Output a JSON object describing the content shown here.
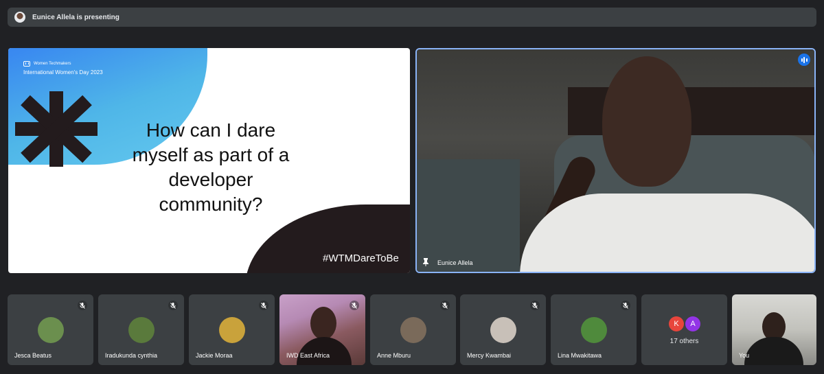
{
  "presenting": {
    "text": "Eunice Allela is presenting"
  },
  "slide": {
    "brand": "Women Techmakers",
    "event": "International Women's Day 2023",
    "title": "How can I dare myself as part of a developer community?",
    "hashtag": "#WTMDareToBe"
  },
  "main_video": {
    "name": "Eunice Allela",
    "speaking": true
  },
  "participants": [
    {
      "name": "Jesca Beatus",
      "muted": true,
      "avatar_color": "#6b8f4e"
    },
    {
      "name": "Iradukunda cynthia",
      "muted": true,
      "avatar_color": "#5a7a3c"
    },
    {
      "name": "Jackie Moraa",
      "muted": true,
      "avatar_color": "#c9a23b"
    },
    {
      "name": "IWD East Africa",
      "muted": true,
      "video": true
    },
    {
      "name": "Anne Mburu",
      "muted": true,
      "avatar_color": "#7a6a5a"
    },
    {
      "name": "Mercy Kwambai",
      "muted": true,
      "avatar_color": "#c8c0b8"
    },
    {
      "name": "Lina Mwakitawa",
      "muted": true,
      "avatar_color": "#4f8a3c"
    }
  ],
  "others": {
    "initials": [
      "K",
      "A"
    ],
    "colors": [
      "#e8453c",
      "#9334e6"
    ],
    "count_label": "17 others"
  },
  "self": {
    "name": "You"
  }
}
